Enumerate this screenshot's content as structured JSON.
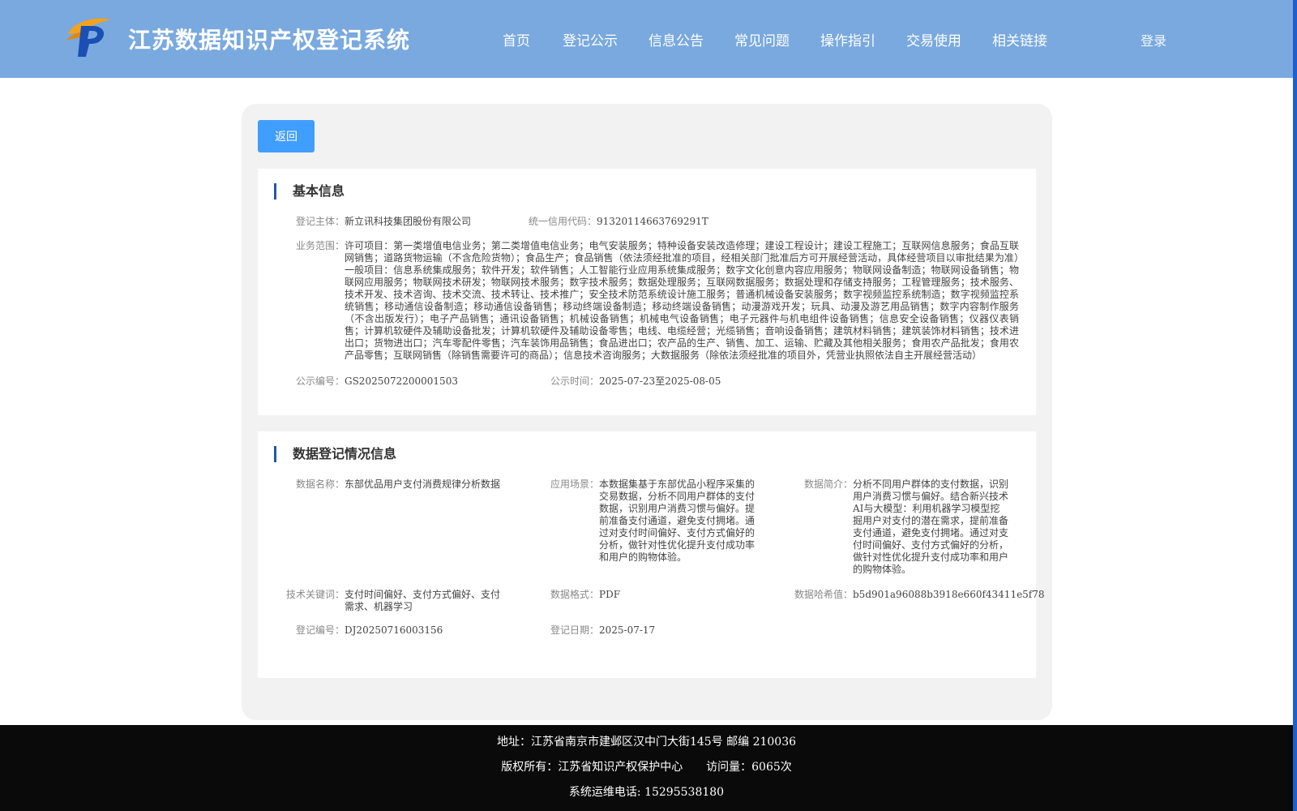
{
  "header": {
    "site_title": "江苏数据知识产权登记系统",
    "nav": [
      "首页",
      "登记公示",
      "信息公告",
      "常见问题",
      "操作指引",
      "交易使用",
      "相关链接"
    ],
    "login": "登录"
  },
  "back_label": "返回",
  "basic_info": {
    "title": "基本信息",
    "subject_label": "登记主体：",
    "subject_value": "新立讯科技集团股份有限公司",
    "credit_label": "统一信用代码：",
    "credit_value": "91320114663769291T",
    "scope_label": "业务范围：",
    "scope_value": "许可项目：第一类增值电信业务；第二类增值电信业务；电气安装服务；特种设备安装改造修理；建设工程设计；建设工程施工；互联网信息服务；食品互联网销售；道路货物运输（不含危险货物）；食品生产；食品销售（依法须经批准的项目，经相关部门批准后方可开展经营活动，具体经营项目以审批结果为准）一般项目：信息系统集成服务；软件开发；软件销售；人工智能行业应用系统集成服务；数字文化创意内容应用服务；物联网设备制造；物联网设备销售；物联网应用服务；物联网技术研发；物联网技术服务；数字技术服务；数据处理服务；互联网数据服务；数据处理和存储支持服务；工程管理服务；技术服务、技术开发、技术咨询、技术交流、技术转让、技术推广；安全技术防范系统设计施工服务；普通机械设备安装服务；数字视频监控系统制造；数字视频监控系统销售；移动通信设备制造；移动通信设备销售；移动终端设备制造；移动终端设备销售；动漫游戏开发；玩具、动漫及游艺用品销售；数字内容制作服务（不含出版发行）；电子产品销售；通讯设备销售；机械设备销售；机械电气设备销售；电子元器件与机电组件设备销售；信息安全设备销售；仪器仪表销售；计算机软硬件及辅助设备批发；计算机软硬件及辅助设备零售；电线、电缆经营；光缆销售；音响设备销售；建筑材料销售；建筑装饰材料销售；技术进出口；货物进出口；汽车零配件零售；汽车装饰用品销售；食品进出口；农产品的生产、销售、加工、运输、贮藏及其他相关服务；食用农产品批发；食用农产品零售；互联网销售（除销售需要许可的商品）；信息技术咨询服务；大数据服务（除依法须经批准的项目外，凭营业执照依法自主开展经营活动）",
    "pub_no_label": "公示编号：",
    "pub_no_value": "GS2025072200001503",
    "pub_time_label": "公示时间：",
    "pub_time_value": "2025-07-23至2025-08-05"
  },
  "data_info": {
    "title": "数据登记情况信息",
    "name_label": "数据名称：",
    "name_value": "东部优品用户支付消费规律分析数据",
    "scene_label": "应用场景：",
    "scene_value": "本数据集基于东部优品小程序采集的交易数据，分析不同用户群体的支付数据，识别用户消费习惯与偏好。提前准备支付通道，避免支付拥堵。通过对支付时间偏好、支付方式偏好的分析，做针对性优化提升支付成功率和用户的购物体验。",
    "intro_label": "数据简介：",
    "intro_value": "分析不同用户群体的支付数据，识别用户消费习惯与偏好。结合新兴技术AI与大模型：利用机器学习模型挖掘用户对支付的潜在需求，提前准备支付通道，避免支付拥堵。通过对支付时间偏好、支付方式偏好的分析，做针对性优化提升支付成功率和用户的购物体验。",
    "keywords_label": "技术关键词：",
    "keywords_value": "支付时间偏好、支付方式偏好、支付需求、机器学习",
    "format_label": "数据格式：",
    "format_value": "PDF",
    "hash_label": "数据哈希值：",
    "hash_value": "b5d901a96088b3918e660f43411e5f78",
    "reg_no_label": "登记编号：",
    "reg_no_value": "DJ20250716003156",
    "reg_date_label": "登记日期：",
    "reg_date_value": "2025-07-17"
  },
  "footer": {
    "address": "地址：江苏省南京市建邺区汉中门大街145号 邮编 210036",
    "copyright": "版权所有：江苏省知识产权保护中心",
    "visits": "访问量：6065次",
    "phone": "系统运维电话: 15295538180"
  },
  "colors": {
    "header_bg": "#79a9de",
    "button": "#409eff",
    "accent": "#2157a3",
    "footer_bg": "#0a0a0a"
  }
}
